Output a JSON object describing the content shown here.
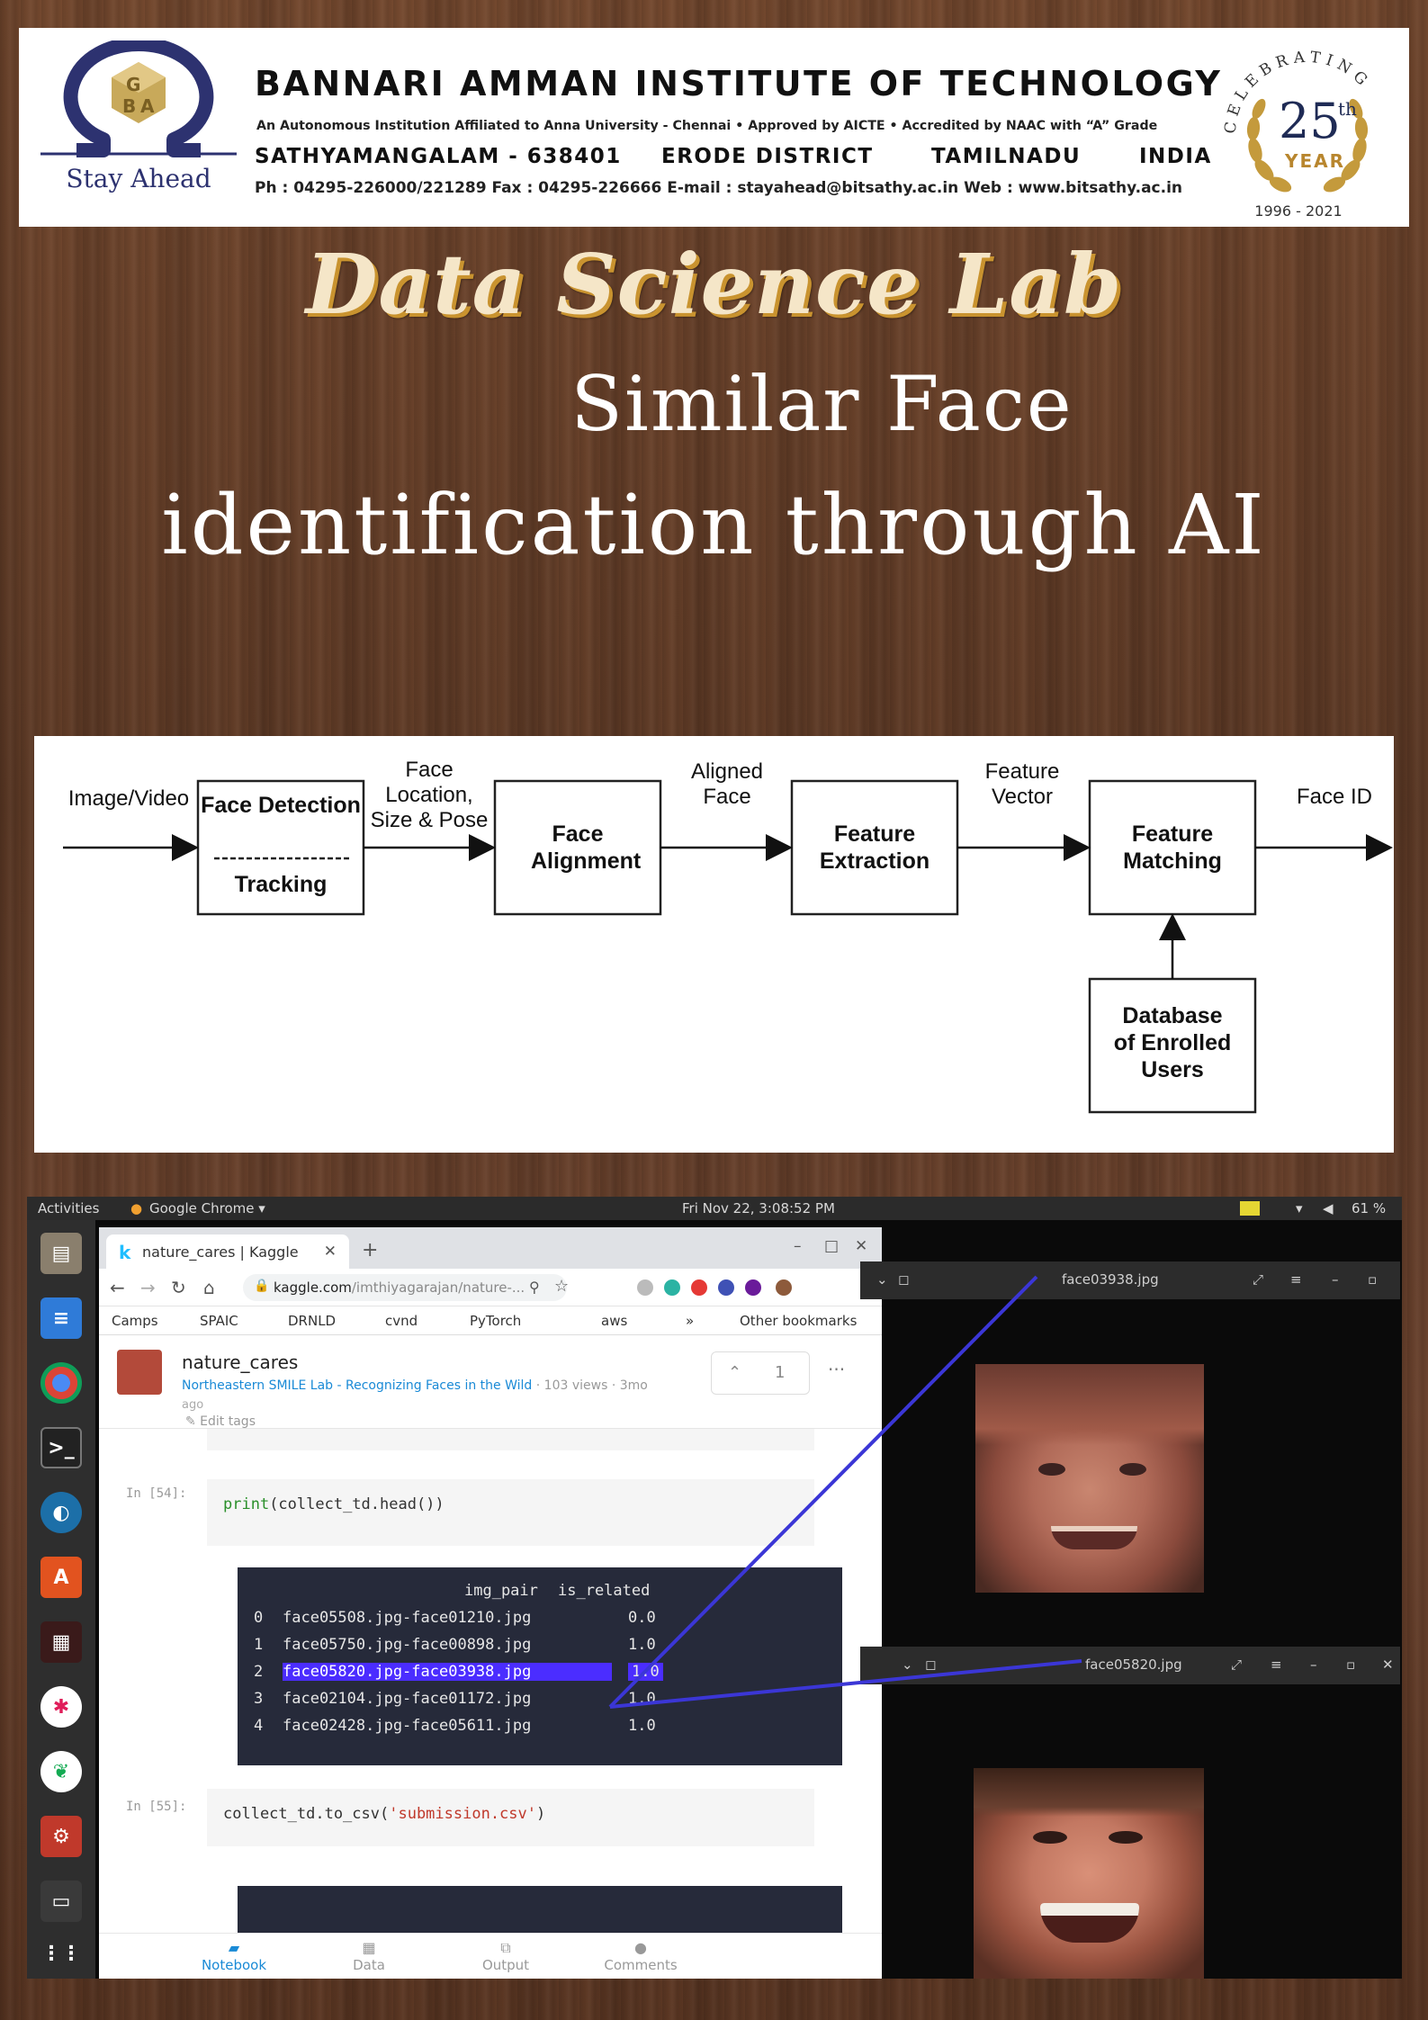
{
  "header": {
    "logo_tagline": "Stay Ahead",
    "institution": "BANNARI  AMMAN  INSTITUTE  OF  TECHNOLOGY",
    "subtitle": "An Autonomous Institution Affiliated to Anna University - Chennai • Approved by AICTE • Accredited by NAAC with “A” Grade",
    "address": {
      "city": "SATHYAMANGALAM  -  638401",
      "district": "ERODE DISTRICT",
      "state": "TAMILNADU",
      "country": "INDIA"
    },
    "contact": "Ph : 04295-226000/221289  Fax : 04295-226666  E-mail : stayahead@bitsathy.ac.in  Web : www.bitsathy.ac.in",
    "anniversary": {
      "celebrating": "CELEBRATING",
      "number": "25",
      "suffix": "th",
      "year_label": "YEAR",
      "dates": "1996 - 2021"
    }
  },
  "titles": {
    "lab": "Data Science Lab",
    "line1": "Similar Face",
    "line2": "identification through AI"
  },
  "diagram": {
    "input_label": "Image/Video",
    "box_detection_top": "Face Detection",
    "box_detection_bottom": "Tracking",
    "arrow1_label": "Face Location, Size & Pose",
    "box_alignment": "Face Alignment",
    "arrow2_label": "Aligned Face",
    "box_extraction": "Feature Extraction",
    "arrow3_label": "Feature Vector",
    "box_matching": "Feature Matching",
    "output_label": "Face ID",
    "box_database": "Database of Enrolled Users"
  },
  "screenshot": {
    "topbar": {
      "activities": "Activities",
      "app": "Google Chrome ▾",
      "datetime": "Fri Nov 22,  3:08:52 PM",
      "battery": "61 %"
    },
    "browser": {
      "tab_title": "nature_cares | Kaggle",
      "url_main": "kaggle.com",
      "url_rest": "/imthiyagarajan/nature-...",
      "bookmarks": [
        "Camps",
        "SPAIC",
        "DRNLD",
        "cvnd",
        "PyTorch",
        "aws",
        "»",
        "Other bookmarks"
      ]
    },
    "kernel": {
      "name": "nature_cares",
      "competition": "Northeastern SMILE Lab - Recognizing Faces in the Wild",
      "views": " · 103 views · 3mo",
      "ago": "ago",
      "edit_tags": "✎ Edit tags",
      "votes": "1"
    },
    "cells": [
      {
        "label": "In [54]:",
        "code_fn": "print",
        "code_rest": "(collect_td.head())"
      },
      {
        "label": "In [55]:",
        "code_fn": "collect_td.to_csv(",
        "code_str": "'submission.csv'",
        "code_end": ")"
      }
    ],
    "output": {
      "columns": [
        "img_pair",
        "is_related"
      ],
      "rows": [
        {
          "index": "0",
          "img_pair": "face05508.jpg-face01210.jpg",
          "is_related": "0.0"
        },
        {
          "index": "1",
          "img_pair": "face05750.jpg-face00898.jpg",
          "is_related": "1.0"
        },
        {
          "index": "2",
          "img_pair": "face05820.jpg-face03938.jpg",
          "is_related": "1.0"
        },
        {
          "index": "3",
          "img_pair": "face02104.jpg-face01172.jpg",
          "is_related": "1.0"
        },
        {
          "index": "4",
          "img_pair": "face02428.jpg-face05611.jpg",
          "is_related": "1.0"
        }
      ],
      "highlighted_row": 2
    },
    "footer_tabs": [
      "Notebook",
      "Data",
      "Output",
      "Comments"
    ],
    "viewers": [
      {
        "filename": "face03938.jpg"
      },
      {
        "filename": "face05820.jpg"
      }
    ]
  },
  "colors": {
    "title_cream": "#f5e6c8",
    "title_gold_shadow": "#c9932f",
    "highlight": "#4b2dff",
    "connector": "#3b36d6"
  }
}
